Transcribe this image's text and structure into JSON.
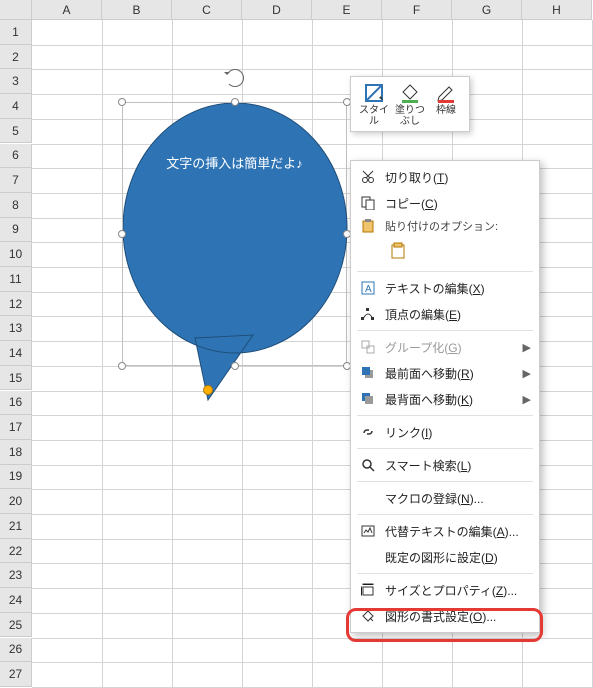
{
  "columns": [
    "A",
    "B",
    "C",
    "D",
    "E",
    "F",
    "G",
    "H"
  ],
  "rows": [
    "1",
    "2",
    "3",
    "4",
    "5",
    "6",
    "7",
    "8",
    "9",
    "10",
    "11",
    "12",
    "13",
    "14",
    "15",
    "16",
    "17",
    "18",
    "19",
    "20",
    "21",
    "22",
    "23",
    "24",
    "25",
    "26",
    "27"
  ],
  "shape": {
    "text": "文字の挿入は簡単だよ♪",
    "fill": "#2e74b5"
  },
  "mini_toolbar": {
    "style": "スタイル",
    "fill": "塗りつぶし",
    "outline": "枠線"
  },
  "context_menu": {
    "cut": "切り取り",
    "cut_key": "T",
    "copy": "コピー",
    "copy_key": "C",
    "paste_label": "貼り付けのオプション:",
    "edit_text": "テキストの編集",
    "edit_text_key": "X",
    "edit_points": "頂点の編集",
    "edit_points_key": "E",
    "group": "グループ化",
    "group_key": "G",
    "bring_front": "最前面へ移動",
    "bring_front_key": "R",
    "send_back": "最背面へ移動",
    "send_back_key": "K",
    "link": "リンク",
    "link_key": "I",
    "smart_lookup": "スマート検索",
    "smart_lookup_key": "L",
    "assign_macro": "マクロの登録",
    "assign_macro_key": "N",
    "alt_text": "代替テキストの編集",
    "alt_text_key": "A",
    "set_default": "既定の図形に設定",
    "set_default_key": "D",
    "size_props": "サイズとプロパティ",
    "size_props_key": "Z",
    "format_shape": "図形の書式設定",
    "format_shape_key": "O"
  }
}
